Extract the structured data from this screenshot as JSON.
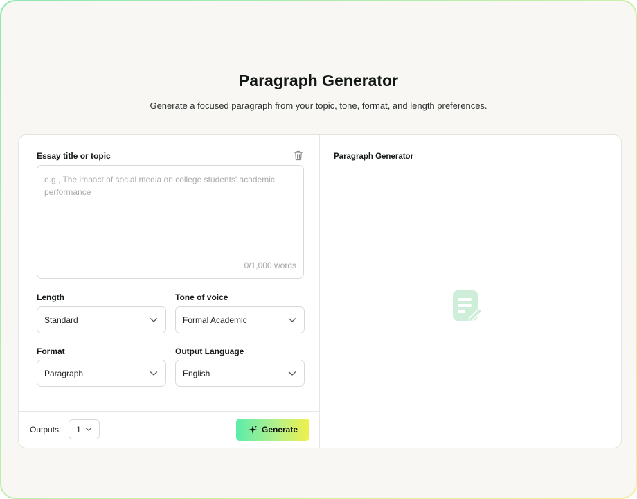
{
  "header": {
    "title": "Paragraph Generator",
    "subtitle": "Generate a focused paragraph from your topic, tone, format, and length preferences."
  },
  "form": {
    "topic_label": "Essay title or topic",
    "topic_value": "",
    "topic_placeholder": "e.g., The impact of social media on college students' academic performance",
    "word_count": "0/1,000 words",
    "length": {
      "label": "Length",
      "value": "Standard"
    },
    "tone": {
      "label": "Tone of voice",
      "value": "Formal Academic"
    },
    "format": {
      "label": "Format",
      "value": "Paragraph"
    },
    "language": {
      "label": "Output Language",
      "value": "English"
    }
  },
  "footer": {
    "outputs_label": "Outputs:",
    "outputs_value": "1",
    "generate_label": "Generate"
  },
  "output_panel": {
    "title": "Paragraph Generator",
    "empty_icon": "document-edit-icon"
  },
  "colors": {
    "accent_gradient_start": "#5cecab",
    "accent_gradient_end": "#f0f04a",
    "empty_icon": "#cfeeda",
    "frame_border": "#8fe8b4"
  }
}
